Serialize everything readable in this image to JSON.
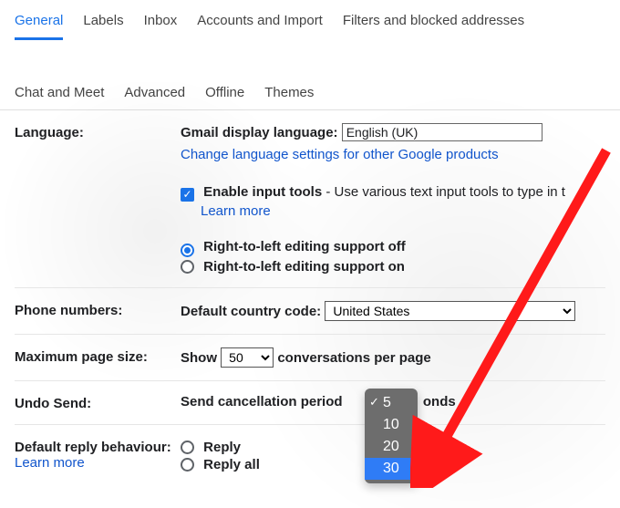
{
  "tabs": {
    "general": "General",
    "labels": "Labels",
    "inbox": "Inbox",
    "accounts": "Accounts and Import",
    "filters": "Filters and blocked addresses",
    "chat": "Chat and Meet",
    "advanced": "Advanced",
    "offline": "Offline",
    "themes": "Themes"
  },
  "language": {
    "label": "Language:",
    "display_label": "Gmail display language:",
    "display_value": "English (UK)",
    "change_link": "Change language settings for other Google products",
    "enable_tools_bold": "Enable input tools",
    "enable_tools_rest": " - Use various text input tools to type in t",
    "learn_more": "Learn more",
    "rtl_off": "Right-to-left editing support off",
    "rtl_on": "Right-to-left editing support on"
  },
  "phone": {
    "label": "Phone numbers:",
    "prefix": "Default country code:",
    "value": "United States"
  },
  "page_size": {
    "label": "Maximum page size:",
    "show": "Show",
    "value": "50",
    "suffix": "conversations per page"
  },
  "undo": {
    "label": "Undo Send:",
    "prefix": "Send cancellation period",
    "suffix": "onds",
    "options": [
      "5",
      "10",
      "20",
      "30"
    ]
  },
  "reply": {
    "label": "Default reply behaviour:",
    "reply": "Reply",
    "reply_all": "Reply all",
    "learn_more": "Learn more"
  }
}
